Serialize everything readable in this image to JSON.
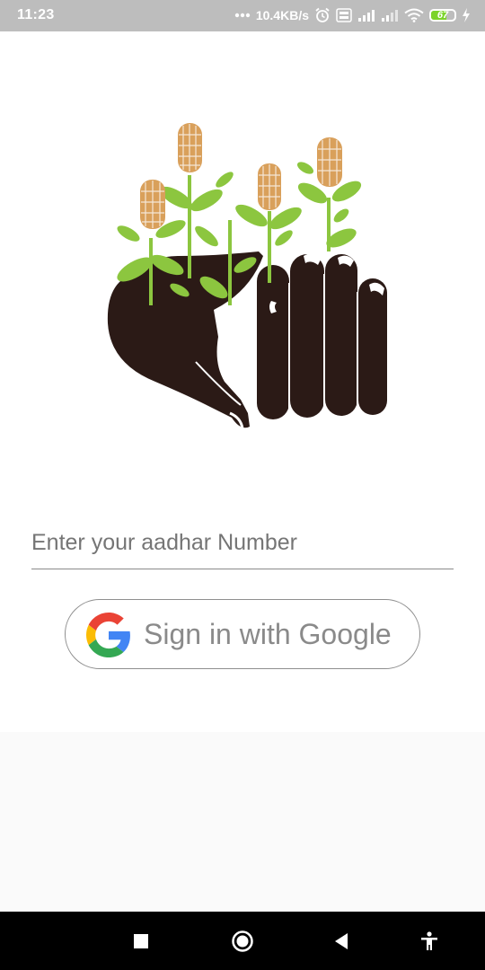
{
  "status_bar": {
    "time": "11:23",
    "net_speed": "10.4KB/s",
    "battery_level": "67",
    "battery_fraction": 0.67,
    "icons": [
      "dots-icon",
      "alarm-icon",
      "volte-icon",
      "signal-icon",
      "signal-icon",
      "wifi-icon",
      "battery-icon",
      "charging-icon"
    ]
  },
  "login": {
    "aadhar_placeholder": "Enter your aadhar Number",
    "aadhar_value": "",
    "google_button_label": "Sign in with Google"
  },
  "colors": {
    "status_bar": "#bdbdbd",
    "soil": "#2b1a16",
    "leaf": "#8cc63f",
    "corn": "#d9a05b",
    "google_blue": "#4285F4",
    "google_red": "#EA4335",
    "google_yellow": "#FBBC05",
    "google_green": "#34A853"
  },
  "nav_bar": {
    "buttons": [
      "recents-icon",
      "home-icon",
      "back-icon",
      "accessibility-icon"
    ]
  }
}
